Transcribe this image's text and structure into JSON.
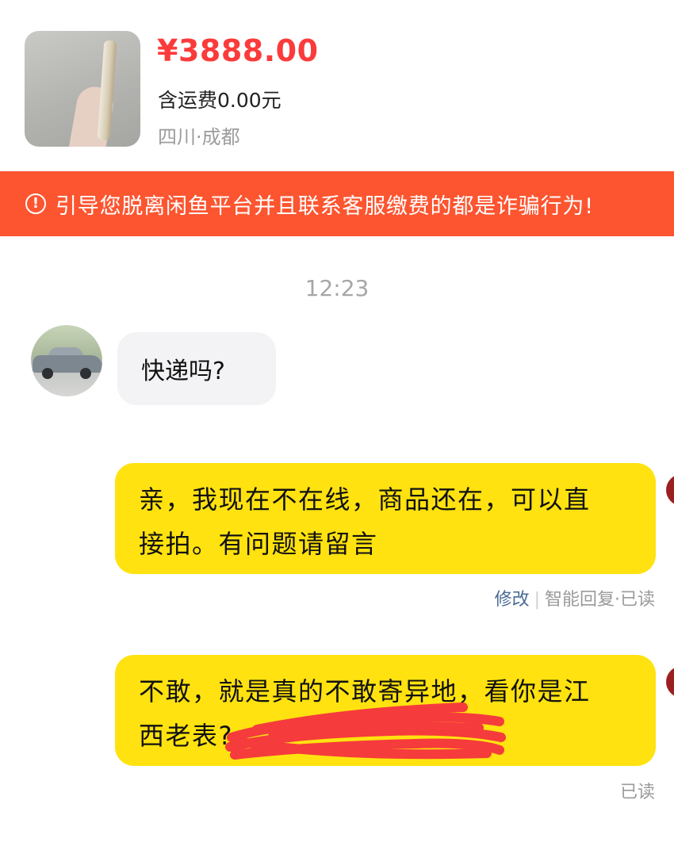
{
  "product": {
    "price": "¥3888.00",
    "shipping": "含运费0.00元",
    "location": "四川·成都"
  },
  "banner": {
    "icon": "exclamation-circle-icon",
    "text": "引导您脱离闲鱼平台并且联系客服缴费的都是诈骗行为!"
  },
  "chat": {
    "time": "12:23",
    "incoming": {
      "text": "快递吗?"
    },
    "outgoing": [
      {
        "line1": "亲，我现在不在线，商品还在，可以直",
        "line2": "接拍。有问题请留言"
      },
      {
        "line1": "不敢，就是真的不敢寄异地，看你是江",
        "line2": "西老表?"
      }
    ],
    "meta1": {
      "edit": "修改",
      "status": "智能回复·已读"
    },
    "meta2": {
      "status": "已读"
    }
  },
  "colors": {
    "price": "#fb3b3b",
    "banner": "#fc5530",
    "outgoing_bubble": "#ffe20f",
    "incoming_bubble": "#f3f3f5",
    "scribble": "#f5333f"
  }
}
